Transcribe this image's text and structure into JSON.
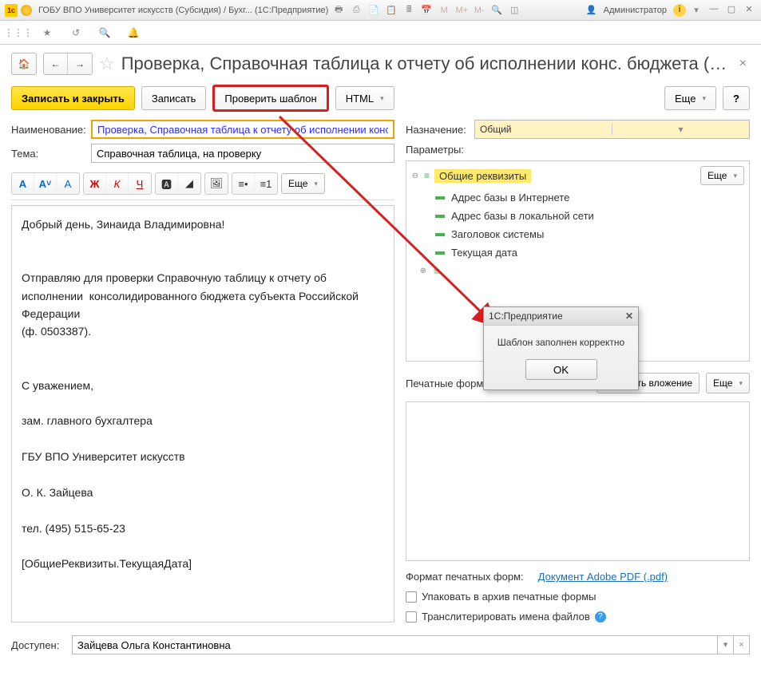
{
  "titlebar": {
    "text": "ГОБУ ВПО Университет искусств (Субсидия) / Бухг... (1С:Предприятие)",
    "user": "Администратор"
  },
  "page": {
    "title": "Проверка, Справочная таблица к отчету об исполнении конс. бюджета (Шаблон ..."
  },
  "cmd": {
    "save_close": "Записать и закрыть",
    "save": "Записать",
    "check": "Проверить шаблон",
    "html": "HTML",
    "more": "Еще",
    "help": "?"
  },
  "fields": {
    "name_label": "Наименование:",
    "name_value": "Проверка, Справочная таблица к отчету об исполнении конс. б",
    "subject_label": "Тема:",
    "subject_value": "Справочная таблица, на проверку",
    "purpose_label": "Назначение:",
    "purpose_value": "Общий",
    "params_label": "Параметры:",
    "avail_label": "Доступен:",
    "avail_value": "Зайцева Ольга Константиновна"
  },
  "fmtbar": {
    "more": "Еще"
  },
  "editor_body": "Добрый день, Зинаида Владимировна!\n\n\nОтправляю для проверки Справочную таблицу к отчету об исполнении  консолидированного бюджета субъекта Российской Федерации\n(ф. 0503387).\n\n\nС уважением,\n\nзам. главного бухгалтера\n\nГБУ ВПО Университет искусств\n\nО. К. Зайцева\n\nтел. (495) 515-65-23\n\n[ОбщиеРеквизиты.ТекущаяДата]",
  "params": {
    "root": "Общие реквизиты",
    "items": [
      "Адрес базы в Интернете",
      "Адрес базы в локальной сети",
      "Заголовок системы",
      "Текущая дата"
    ]
  },
  "attach": {
    "label": "Печатные формы и вложения:",
    "add": "Добавить вложение",
    "more": "Еще",
    "format_label": "Формат печатных форм:",
    "format_link": "Документ Adobe PDF (.pdf)",
    "pack": "Упаковать в архив печатные формы",
    "translit": "Транслитерировать имена файлов"
  },
  "dialog": {
    "title": "1С:Предприятие",
    "msg": "Шаблон заполнен корректно",
    "ok": "OK"
  }
}
